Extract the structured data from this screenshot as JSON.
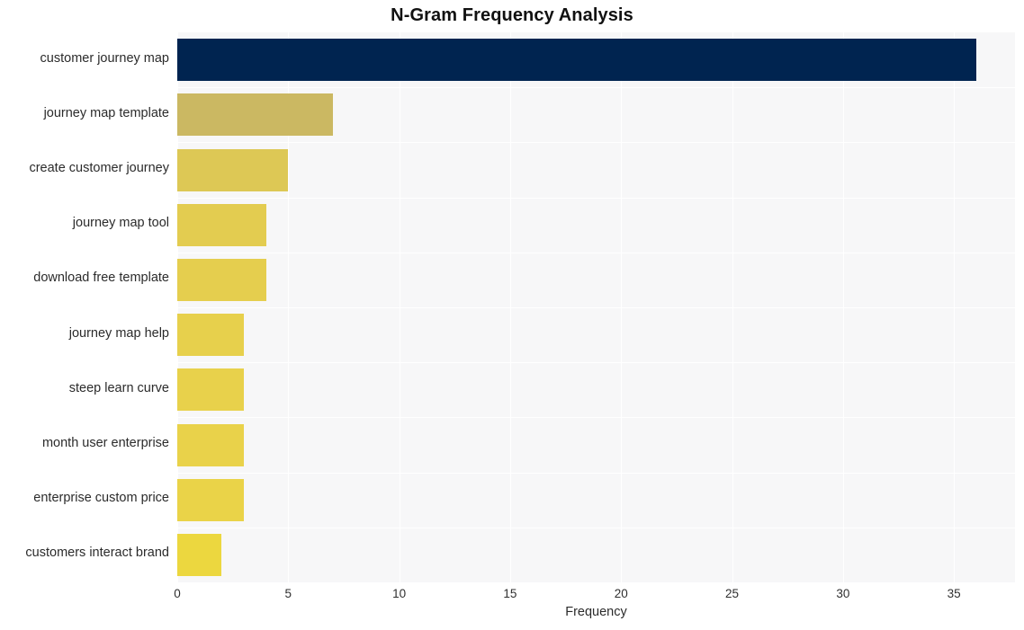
{
  "chart_data": {
    "type": "bar",
    "orientation": "horizontal",
    "title": "N-Gram Frequency Analysis",
    "xlabel": "Frequency",
    "ylabel": "",
    "categories": [
      "customer journey map",
      "journey map template",
      "create customer journey",
      "journey map tool",
      "download free template",
      "journey map help",
      "steep learn curve",
      "month user enterprise",
      "enterprise custom price",
      "customers interact brand"
    ],
    "values": [
      36,
      7,
      5,
      4,
      4,
      3,
      3,
      3,
      3,
      2
    ],
    "bar_colors": [
      "#002450",
      "#cbb862",
      "#ddc855",
      "#e3cc50",
      "#e5ce4e",
      "#e7d04c",
      "#e8d14b",
      "#e9d24a",
      "#ead348",
      "#ecd73f"
    ],
    "xlim": [
      0,
      37.75
    ],
    "xticks": [
      0,
      5,
      10,
      15,
      20,
      25,
      30,
      35
    ],
    "xtick_labels": [
      "0",
      "5",
      "10",
      "15",
      "20",
      "25",
      "30",
      "35"
    ],
    "grid": true,
    "grid_color": "#ffffff",
    "plot_background": "#f7f7f8",
    "figure_background": "#ffffff",
    "legend": null,
    "legend_position": "none"
  }
}
